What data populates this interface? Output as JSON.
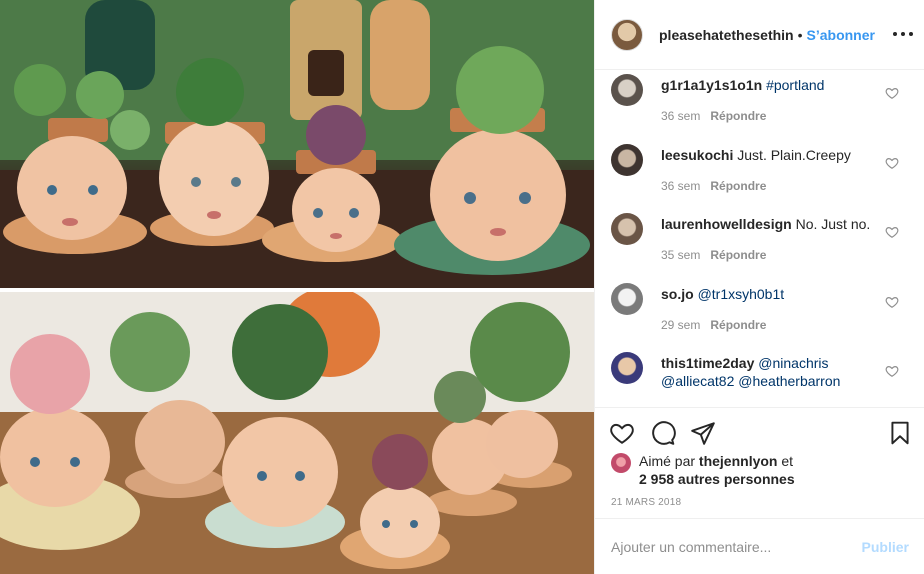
{
  "header": {
    "username": "pleasehatethesethin",
    "separator": "•",
    "follow_label": "S’abonner",
    "more_icon": "more-horizontal-icon"
  },
  "comments": [
    {
      "username": "g1r1a1y1s1o1n",
      "text": "",
      "mentions": "#portland",
      "time": "36 sem",
      "reply_label": "Répondre",
      "avatar_color": "#9a8f86"
    },
    {
      "username": "leesukochi",
      "text": "Just. Plain.Creepy",
      "mentions": "",
      "time": "36 sem",
      "reply_label": "Répondre",
      "avatar_color": "#6b5a4e"
    },
    {
      "username": "laurenhowelldesign",
      "text": "No. Just no.",
      "mentions": "",
      "time": "35 sem",
      "reply_label": "Répondre",
      "avatar_color": "#7d6b5c"
    },
    {
      "username": "so.jo",
      "text": "",
      "mentions": "@tr1xsyh0b1t",
      "time": "29 sem",
      "reply_label": "Répondre",
      "avatar_color": "#b8b8b8"
    },
    {
      "username": "this1time2day",
      "text": "",
      "mentions": "@ninachris",
      "mentions_line2": "@alliecat82 @heatherbarron",
      "time": "",
      "reply_label": "",
      "avatar_color": "#4a4a8a"
    }
  ],
  "actions": {
    "like_icon": "heart-icon",
    "comment_icon": "comment-icon",
    "share_icon": "share-icon",
    "save_icon": "bookmark-icon"
  },
  "likes": {
    "prefix": "Aimé par",
    "user": "thejennlyon",
    "connector": "et",
    "others": "2 958 autres personnes"
  },
  "date": "21 MARS 2018",
  "add_comment": {
    "placeholder": "Ajouter un commentaire...",
    "publish_label": "Publier"
  },
  "colors": {
    "accent": "#3897f0",
    "publish_disabled": "#b3dbff",
    "meta_gray": "#8e8e8e",
    "link_blue": "#003569"
  }
}
